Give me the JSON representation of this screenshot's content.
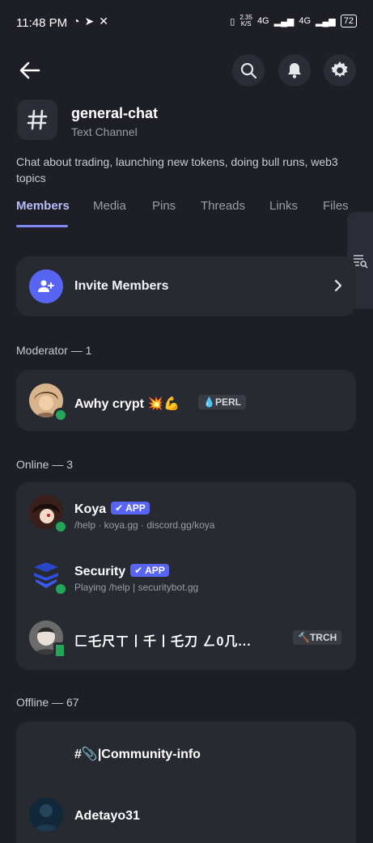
{
  "status_bar": {
    "time": "11:48 PM",
    "speed_value": "2.35",
    "speed_unit": "K/S",
    "network": "4G",
    "battery": "72"
  },
  "channel": {
    "name": "general-chat",
    "type": "Text Channel",
    "description": "Chat about trading, launching new tokens, doing bull runs, web3 topics"
  },
  "tabs": [
    "Members",
    "Media",
    "Pins",
    "Threads",
    "Links",
    "Files"
  ],
  "invite": {
    "label": "Invite Members"
  },
  "moderator_section": {
    "title": "Moderator — 1",
    "members": [
      {
        "name": "Awhy crypt 💥💪",
        "tag": "💧PERL"
      }
    ]
  },
  "online_section": {
    "title": "Online — 3",
    "members": [
      {
        "name": "Koya",
        "badge": "✔ APP",
        "subtitle": "/help · koya.gg · discord.gg/koya"
      },
      {
        "name": "Security",
        "badge": "✔ APP",
        "subtitle": "Playing /help | securitybot.gg"
      },
      {
        "name": "匚乇尺ㄒ丨千丨乇刀  ㄥ0几...",
        "tag": "🔨TRCH"
      }
    ]
  },
  "offline_section": {
    "title": "Offline — 67",
    "members": [
      {
        "name": "#📎|Community-info"
      },
      {
        "name": "Adetayo31"
      }
    ]
  },
  "colors": {
    "background": "#1e1f26",
    "card": "#282a32",
    "accent": "#5865f2",
    "online": "#23a55a"
  }
}
